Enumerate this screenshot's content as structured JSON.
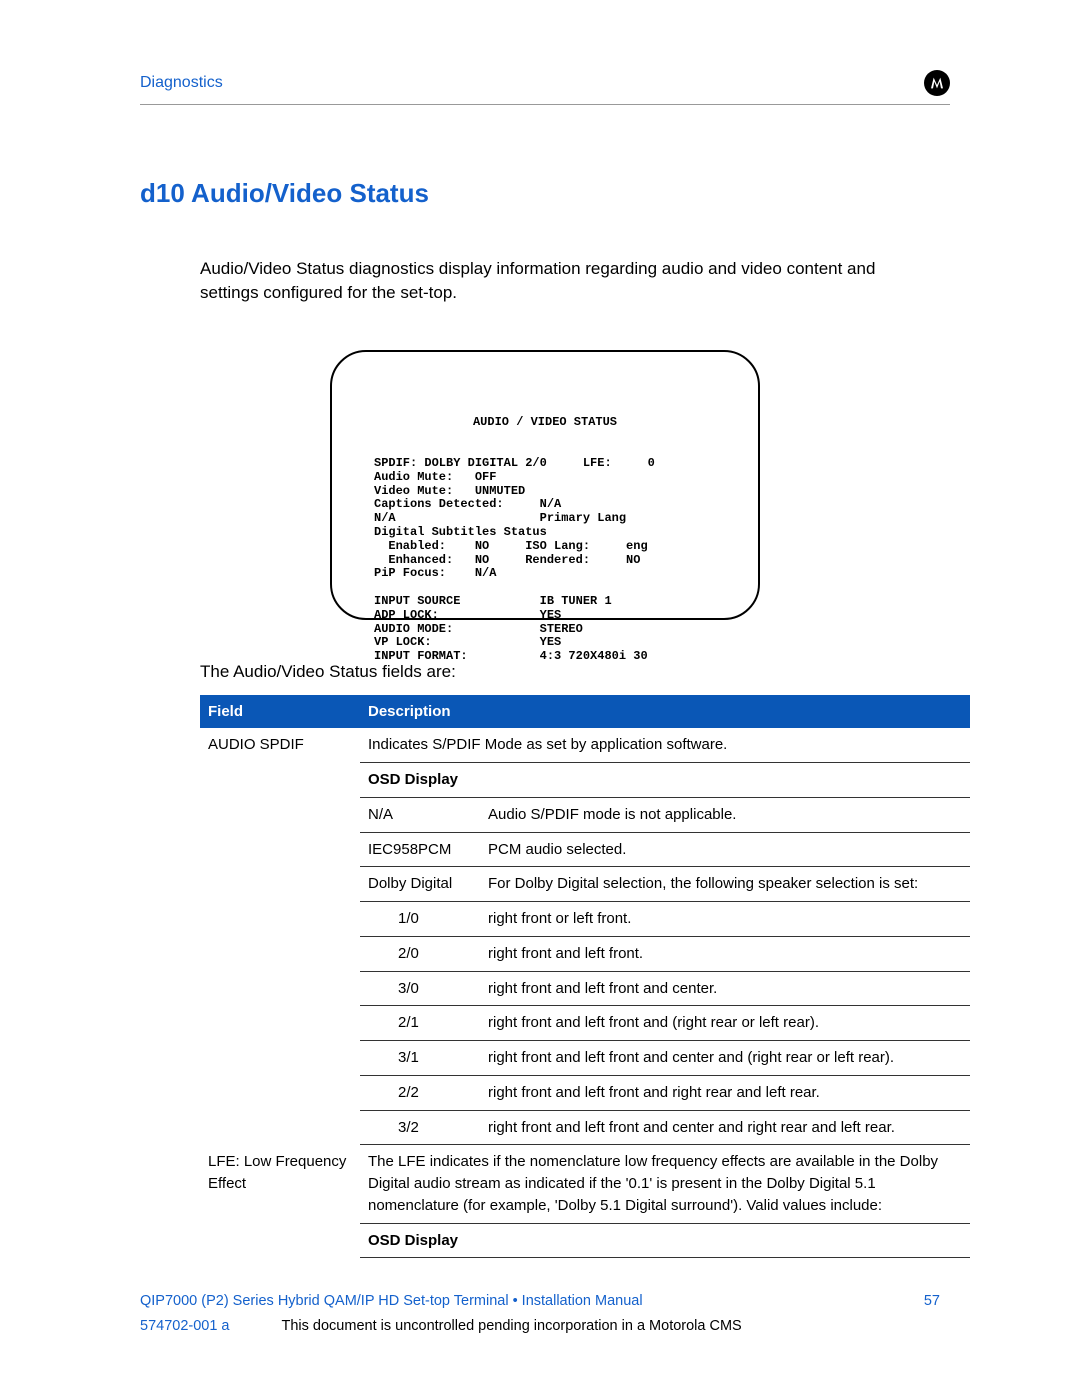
{
  "header": {
    "breadcrumb": "Diagnostics",
    "logo_alt": "M"
  },
  "section": {
    "title": "d10 Audio/Video Status",
    "intro": "Audio/Video Status diagnostics display information regarding audio and video content and settings configured for the set-top."
  },
  "osd": {
    "title": "AUDIO / VIDEO STATUS",
    "lines": [
      "SPDIF: DOLBY DIGITAL 2/0     LFE:     0",
      "Audio Mute:   OFF",
      "Video Mute:   UNMUTED",
      "Captions Detected:     N/A",
      "N/A                    Primary Lang",
      "Digital Subtitles Status",
      "  Enabled:    NO     ISO Lang:     eng",
      "  Enhanced:   NO     Rendered:     NO",
      "PiP Focus:    N/A",
      "",
      "INPUT SOURCE           IB TUNER 1",
      "ADP LOCK:              YES",
      "AUDIO MODE:            STEREO",
      "VP LOCK:               YES",
      "INPUT FORMAT:          4:3 720X480i 30"
    ]
  },
  "fields_caption": "The Audio/Video Status fields are:",
  "table": {
    "headers": {
      "field": "Field",
      "description": "Description"
    },
    "rows": [
      {
        "field": "AUDIO SPDIF",
        "desc": "Indicates S/PDIF Mode as set by application software.",
        "sub": {
          "header": "OSD Display",
          "rows": [
            {
              "k": "N/A",
              "v": "Audio S/PDIF mode is not applicable.",
              "indent": false
            },
            {
              "k": "IEC958PCM",
              "v": "PCM audio selected.",
              "indent": false
            },
            {
              "k": "Dolby Digital",
              "v": "For Dolby Digital selection, the following speaker selection is set:",
              "indent": false
            },
            {
              "k": "1/0",
              "v": "right front or left front.",
              "indent": true
            },
            {
              "k": "2/0",
              "v": "right front and left front.",
              "indent": true
            },
            {
              "k": "3/0",
              "v": "right front and left front and center.",
              "indent": true
            },
            {
              "k": "2/1",
              "v": "right front and left front and (right rear or left rear).",
              "indent": true
            },
            {
              "k": "3/1",
              "v": "right front and left front and center and (right rear or left rear).",
              "indent": true
            },
            {
              "k": "2/2",
              "v": "right front and left front and right rear and left rear.",
              "indent": true
            },
            {
              "k": "3/2",
              "v": "right front and left front and center and right rear and left rear.",
              "indent": true
            }
          ]
        }
      },
      {
        "field": "LFE: Low Frequency Effect",
        "desc": "The LFE indicates if the nomenclature low frequency effects are available in the Dolby Digital audio stream as indicated if the '0.1' is present in the Dolby Digital 5.1 nomenclature (for example, 'Dolby 5.1 Digital surround'). Valid values include:",
        "sub": {
          "header": "OSD Display",
          "rows": []
        }
      }
    ]
  },
  "footer": {
    "title": "QIP7000 (P2) Series Hybrid QAM/IP HD Set-top Terminal • Installation Manual",
    "page": "57",
    "docnum": "574702-001 a",
    "disclaimer": "This document is uncontrolled pending incorporation in a Motorola CMS"
  }
}
